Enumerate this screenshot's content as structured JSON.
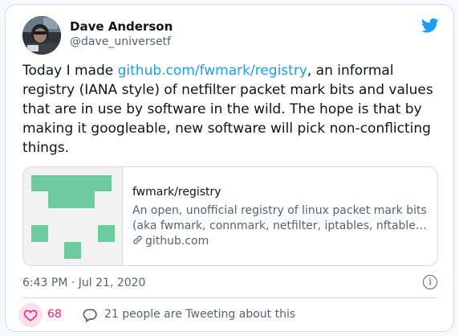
{
  "author": {
    "name": "Dave Anderson",
    "handle": "@dave_universetf"
  },
  "tweet": {
    "text_before": "Today I made ",
    "link": "github.com/fwmark/registry",
    "text_after": ", an informal registry (IANA style) of netfilter packet mark bits and values that are in use by software in the wild. The hope is that by making it googleable, new software will pick non-conflicting things."
  },
  "link_card": {
    "title": "fwmark/registry",
    "desc_line1": "An open, unofficial registry of linux packet mark bits",
    "desc_line2": "(aka fwmark, connmark, netfilter, iptables, nftables...",
    "domain": "github.com",
    "thumb_color": "#6ecba0"
  },
  "meta": {
    "timestamp": "6:43 PM · Jul 21, 2020",
    "info_icon": "i"
  },
  "actions": {
    "like_count": "68",
    "replies_text": "21 people are Tweeting about this"
  },
  "colors": {
    "accent": "#1d9bf0",
    "like": "#f91880",
    "muted": "#536471"
  }
}
